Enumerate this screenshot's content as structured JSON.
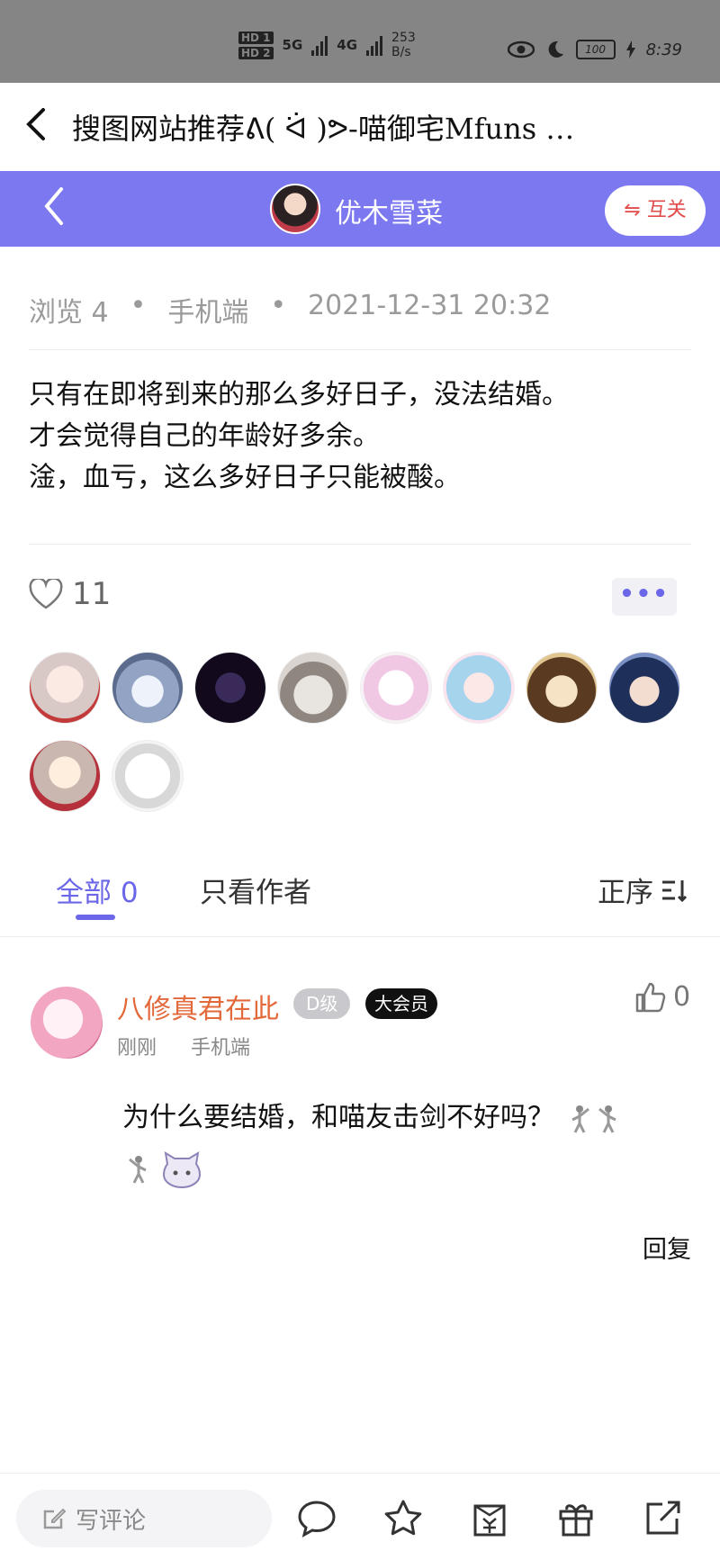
{
  "status_bar": {
    "hd1": "HD 1",
    "hd2": "HD 2",
    "net1": "5G",
    "net2": "4G",
    "speed_value": "253",
    "speed_unit": "B/s",
    "battery": "100",
    "time": "8:39"
  },
  "titlebar": {
    "title": "搜图网站推荐ᕕ( ᐛ )ᕗ-喵御宅Mfuns …"
  },
  "header": {
    "username": "优木雪菜",
    "follow_label": "⇋ 互关"
  },
  "post": {
    "views": "浏览 4",
    "sep1": "•",
    "device": "手机端",
    "sep2": "•",
    "datetime": "2021-12-31 20:32",
    "lines": [
      "只有在即将到来的那么多好日子，没法结婚。",
      "才会觉得自己的年龄好多余。",
      "淦，血亏，这么多好日子只能被酸。"
    ],
    "like_count": "11",
    "more_label": "•••"
  },
  "tabs": {
    "all_label": "全部",
    "all_count": "0",
    "author_label": "只看作者",
    "sort_label": "正序"
  },
  "comment": {
    "name": "八修真君在此",
    "level": "D级",
    "vip": "大会员",
    "like_count": "0",
    "time": "刚刚",
    "device": "手机端",
    "text": "为什么要结婚，和喵友击剑不好吗？",
    "reply_label": "回复"
  },
  "bottom_bar": {
    "comment_placeholder": "写评论"
  },
  "colors": {
    "accent": "#7c79f0",
    "tab_active": "#6b67e8",
    "commenter": "#e3683a"
  }
}
